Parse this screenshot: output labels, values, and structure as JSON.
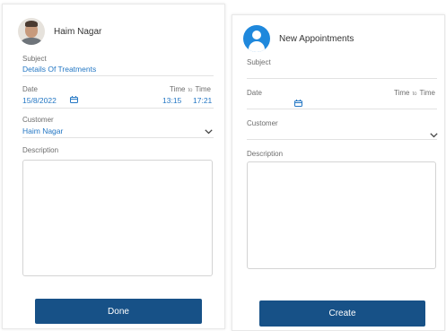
{
  "left_panel": {
    "header": {
      "name": "Haim Nagar"
    },
    "subject": {
      "label": "Subject",
      "value": "Details Of Treatments"
    },
    "date": {
      "label": "Date",
      "value": "15/8/2022"
    },
    "time": {
      "label_start": "Time",
      "to": "to",
      "label_end": "Time",
      "start": "13:15",
      "end": "17:21"
    },
    "customer": {
      "label": "Customer",
      "value": "Haim Nagar"
    },
    "description": {
      "label": "Description",
      "value": ""
    },
    "button": {
      "label": "Done"
    }
  },
  "right_panel": {
    "header": {
      "title": "New Appointments"
    },
    "subject": {
      "label": "Subject",
      "value": ""
    },
    "date": {
      "label": "Date",
      "value": ""
    },
    "time": {
      "label_start": "Time",
      "to": "to",
      "label_end": "Time"
    },
    "customer": {
      "label": "Customer",
      "value": ""
    },
    "description": {
      "label": "Description",
      "value": ""
    },
    "button": {
      "label": "Create"
    }
  },
  "colors": {
    "accent_text": "#2477c4",
    "button_bg": "#175187",
    "avatar_icon_bg": "#1f88dc"
  },
  "icons": [
    "user-photo",
    "user-icon",
    "calendar-icon",
    "chevron-down-icon"
  ]
}
